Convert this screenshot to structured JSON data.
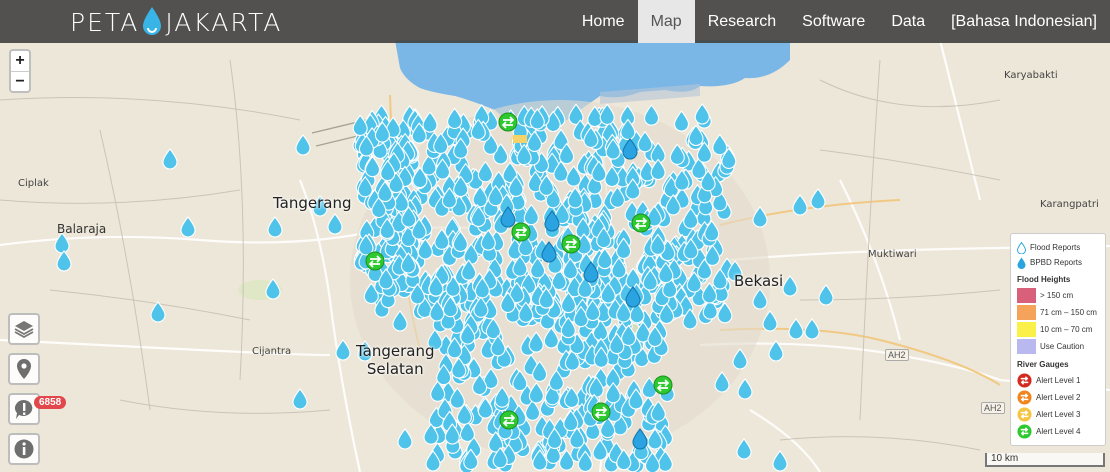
{
  "brand": {
    "left": "PETA",
    "right": "JAKARTA"
  },
  "nav": {
    "items": [
      {
        "label": "Home",
        "active": false
      },
      {
        "label": "Map",
        "active": true
      },
      {
        "label": "Research",
        "active": false
      },
      {
        "label": "Software",
        "active": false
      },
      {
        "label": "Data",
        "active": false
      },
      {
        "label": "[Bahasa Indonesian]",
        "active": false
      }
    ]
  },
  "zoom": {
    "in": "+",
    "out": "−"
  },
  "controls": {
    "report_count": "6858"
  },
  "places": {
    "karyabakti": "Karyabakti",
    "ciplak": "Ciplak",
    "balaraja": "Balaraja",
    "tangerang": "Tangerang",
    "karangpatri": "Karangpatri",
    "muktiwari": "Muktiwari",
    "bekasi": "Bekasi",
    "cijantra": "Cijantra",
    "tangerang_selatan_1": "Tangerang",
    "tangerang_selatan_2": "Selatan"
  },
  "highways": {
    "ah2_a": "AH2",
    "ah2_b": "AH2"
  },
  "legend": {
    "flood_reports": "Flood Reports",
    "bpbd_reports": "BPBD Reports",
    "flood_heights_title": "Flood Heights",
    "heights": [
      {
        "label": "> 150 cm",
        "color": "#d9607a"
      },
      {
        "label": "71 cm – 150 cm",
        "color": "#f5a35a"
      },
      {
        "label": "10 cm – 70 cm",
        "color": "#fbef4a"
      },
      {
        "label": "Use Caution",
        "color": "#b9b9f0"
      }
    ],
    "river_gauges_title": "River Gauges",
    "gauges": [
      {
        "label": "Alert Level 1",
        "color": "#d42a1f"
      },
      {
        "label": "Alert Level 2",
        "color": "#f08520"
      },
      {
        "label": "Alert Level 3",
        "color": "#f5c542"
      },
      {
        "label": "Alert Level 4",
        "color": "#2ec92e"
      }
    ]
  },
  "scale": {
    "label": "10 km"
  },
  "colors": {
    "report": "#4fc3ea",
    "report_stroke": "#1a9fd1",
    "bpbd": "#2aa3e0",
    "water": "#7ab9e8",
    "land": "#ece6d8"
  }
}
